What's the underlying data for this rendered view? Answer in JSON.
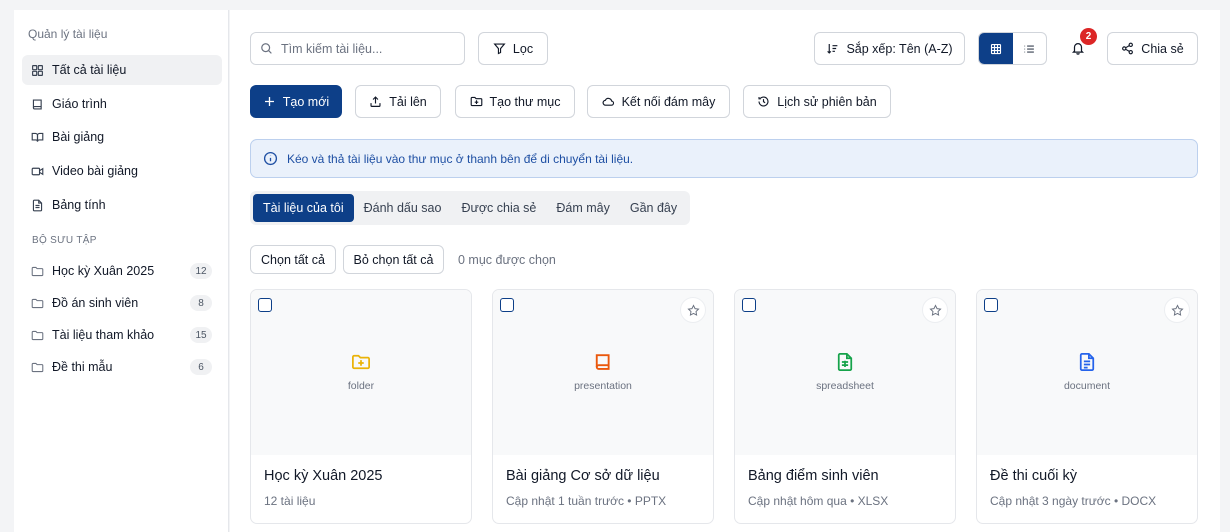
{
  "sidebar": {
    "title": "Quản lý tài liệu",
    "items": [
      {
        "label": "Tất cả tài liệu",
        "icon": "grid-icon"
      },
      {
        "label": "Giáo trình",
        "icon": "book-icon"
      },
      {
        "label": "Bài giảng",
        "icon": "book-open-icon"
      },
      {
        "label": "Video bài giảng",
        "icon": "video-icon"
      },
      {
        "label": "Bảng tính",
        "icon": "file-spreadsheet-icon"
      }
    ],
    "collections_title": "BỘ SƯU TẬP",
    "collections": [
      {
        "label": "Học kỳ Xuân 2025",
        "count": "12"
      },
      {
        "label": "Đồ án sinh viên",
        "count": "8"
      },
      {
        "label": "Tài liệu tham khảo",
        "count": "15"
      },
      {
        "label": "Đề thi mẫu",
        "count": "6"
      }
    ]
  },
  "toolbar": {
    "search_placeholder": "Tìm kiếm tài liệu...",
    "filter_label": "Lọc",
    "sort_label": "Sắp xếp:  Tên (A-Z)",
    "notification_count": "2",
    "share_label": "Chia sẻ"
  },
  "actions": {
    "create_new": "Tạo mới",
    "upload": "Tải lên",
    "create_folder": "Tạo thư mục",
    "connect_cloud": "Kết nối đám mây",
    "version_history": "Lịch sử phiên bản"
  },
  "notice": "Kéo và thả tài liệu vào thư mục ở thanh bên để di chuyển tài liệu.",
  "tabs": [
    "Tài liệu của tôi",
    "Đánh dấu sao",
    "Được chia sẻ",
    "Đám mây",
    "Gần đây"
  ],
  "selection": {
    "select_all": "Chọn tất cả",
    "deselect_all": "Bỏ chọn tất cả",
    "count_text": "0 mục được chọn"
  },
  "cards": [
    {
      "name": "Học kỳ Xuân 2025",
      "type": "folder",
      "meta": "12 tài liệu",
      "color": "#eab308",
      "icon": "folder-plus-icon"
    },
    {
      "name": "Bài giảng Cơ sở dữ liệu",
      "type": "presentation",
      "meta": "Cập nhật 1 tuần trước • PPTX",
      "color": "#ea580c",
      "icon": "book-icon"
    },
    {
      "name": "Bảng điểm sinh viên",
      "type": "spreadsheet",
      "meta": "Cập nhật hôm qua • XLSX",
      "color": "#16a34a",
      "icon": "file-spreadsheet-icon"
    },
    {
      "name": "Đề thi cuối kỳ",
      "type": "document",
      "meta": "Cập nhật 3 ngày trước • DOCX",
      "color": "#2563eb",
      "icon": "file-text-icon"
    }
  ],
  "colors": {
    "primary": "#0d3f88",
    "badge": "#dc2626",
    "notice_bg": "#eaf1fb"
  }
}
